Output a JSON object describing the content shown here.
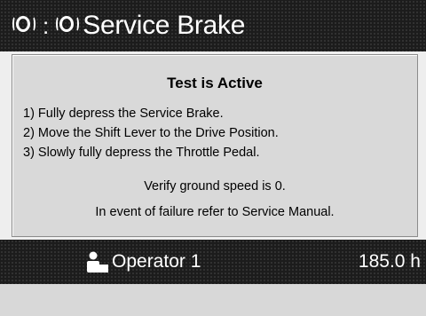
{
  "header": {
    "separator": ":",
    "title": "Service Brake",
    "icon_left": "brake-indicator-icon",
    "icon_right": "brake-indicator-icon"
  },
  "message": {
    "heading": "Test is Active",
    "steps": [
      "1) Fully depress the Service Brake.",
      "2) Move the Shift Lever to the Drive Position.",
      "3) Slowly fully depress the Throttle Pedal."
    ],
    "note_speed": "Verify ground speed is 0.",
    "note_failure": "In event of failure refer to Service Manual."
  },
  "status": {
    "operator_icon": "operator-person-icon",
    "operator": "Operator 1",
    "hours": "185.0 h"
  },
  "colors": {
    "bar_background": "#1c1c1c",
    "message_background": "#d9d9d9",
    "text_light": "#ffffff"
  }
}
